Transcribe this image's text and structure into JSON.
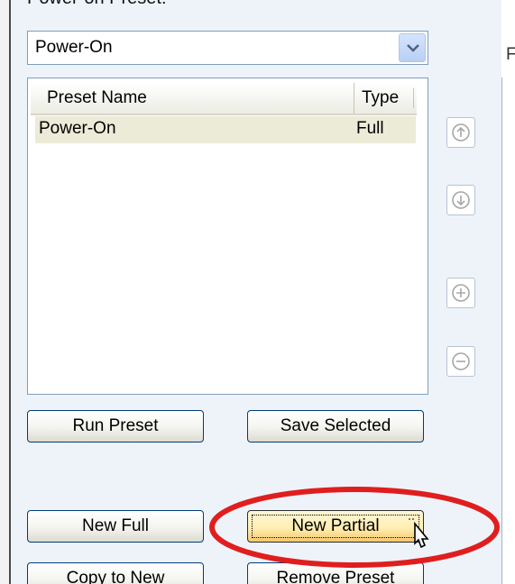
{
  "section": {
    "label": "Power-on Preset:",
    "partial_label": "F"
  },
  "combo": {
    "selected": "Power-On"
  },
  "list": {
    "columns": [
      "Preset Name",
      "Type"
    ],
    "rows": [
      {
        "name": "Power-On",
        "type": "Full"
      }
    ]
  },
  "side_buttons": {
    "move_up": "arrow-up-circle-icon",
    "move_down": "arrow-down-circle-icon",
    "add": "plus-circle-icon",
    "remove": "minus-circle-icon"
  },
  "buttons": {
    "run_preset": "Run Preset",
    "save_selected": "Save Selected",
    "new_full": "New Full",
    "new_partial": "New Partial",
    "copy_to_new": "Copy to New",
    "remove_preset": "Remove Preset"
  },
  "colors": {
    "highlight_ellipse": "#e01e1e",
    "selected_row": "#ecebd8",
    "panel_background": "#eef3fa"
  }
}
